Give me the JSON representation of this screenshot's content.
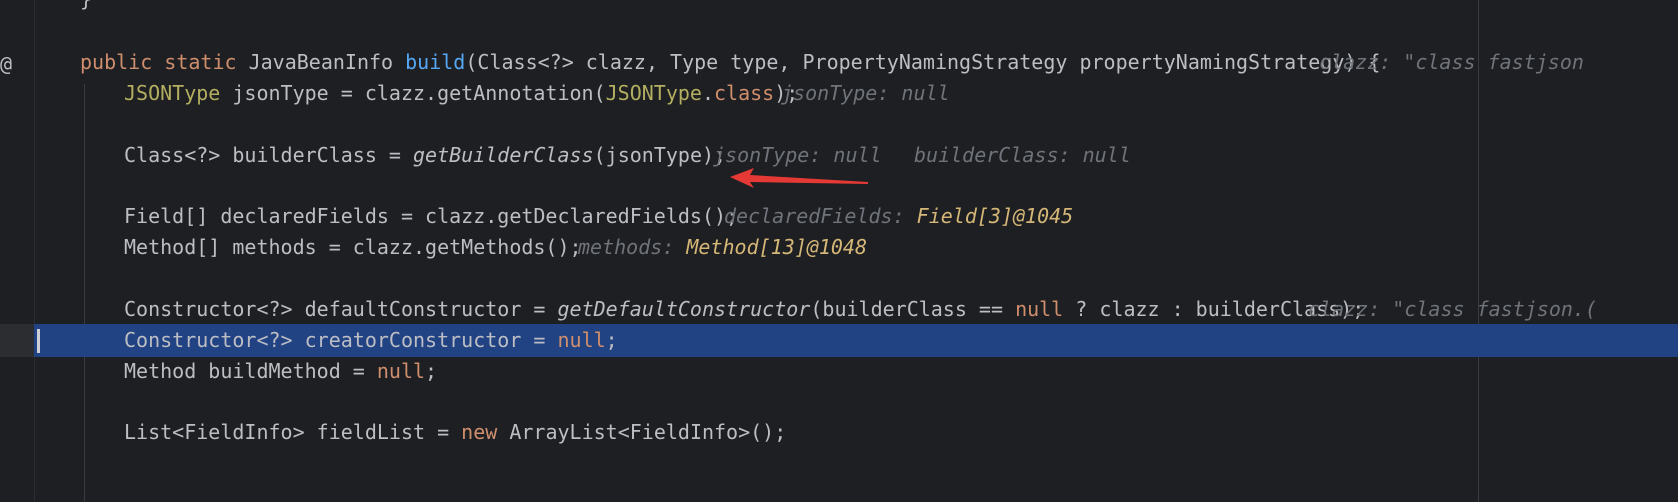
{
  "lines": {
    "l0": {
      "brace": "}"
    },
    "l1": {
      "kw_public": "public",
      "kw_static": "static",
      "type": "JavaBeanInfo",
      "method": "build",
      "params": "(Class<?> clazz, Type type, PropertyNamingStrategy propertyNamingStrategy) {",
      "hint": "clazz: \"class fastjson"
    },
    "l2": {
      "anno_type": "JSONType",
      "mid": " jsonType = clazz.getAnnotation(",
      "anno_arg": "JSONType",
      "dot": ".",
      "kw_class": "class",
      "end": ");",
      "hint": "jsonType: null"
    },
    "l3": {
      "start": "Class<?> builderClass = ",
      "call": "getBuilderClass",
      "end": "(jsonType);",
      "hint1": "jsonType: null",
      "hint2": "builderClass: null"
    },
    "l4": {
      "code": "Field[] declaredFields = clazz.getDeclaredFields();",
      "hint_label": "declaredFields: ",
      "hint_value": "Field[3]@1045"
    },
    "l5": {
      "code": "Method[] methods = clazz.getMethods();",
      "hint_label": "methods: ",
      "hint_value": "Method[13]@1048"
    },
    "l6": {
      "start": "Constructor<?> defaultConstructor = ",
      "call": "getDefaultConstructor",
      "mid": "(builderClass == ",
      "kw_null": "null",
      "end": " ? clazz : builderClass);",
      "hint": "clazz: \"class fastjson.("
    },
    "l7": {
      "start": "Constructor<?> creatorConstructor = ",
      "kw_null": "null",
      "end": ";"
    },
    "l8": {
      "start": "Method buildMethod = ",
      "kw_null": "null",
      "end": ";"
    },
    "l9": {
      "start": "List<FieldInfo> fieldList = ",
      "kw_new": "new",
      "end": " ArrayList<FieldInfo>();"
    }
  },
  "gutter": {
    "icon": "@"
  },
  "colors": {
    "background": "#1e1f22",
    "keyword": "#cf8e6d",
    "method_decl": "#56a8f5",
    "annotation": "#b3ae60",
    "hint": "#6f737a",
    "hint_value": "#d5b778",
    "selection": "#214283",
    "arrow": "#e53935"
  },
  "icons": {
    "gutter": "override-at-icon",
    "arrow": "red-arrow-annotation"
  }
}
